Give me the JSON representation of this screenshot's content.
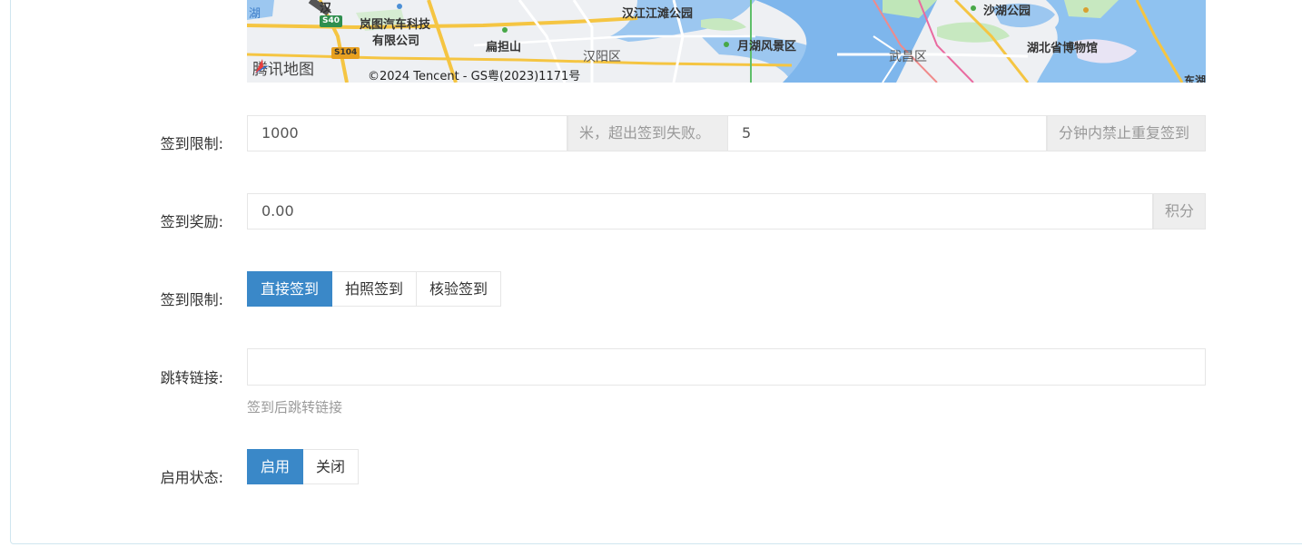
{
  "map": {
    "labels": {
      "han_label": "汉",
      "hu": "湖",
      "langtu": "岚图汽车科技",
      "langtu2": "有限公司",
      "biandanshan": "扁担山",
      "hanyang_district": "汉阳区",
      "hanjiang_park": "汉江江滩公园",
      "yuehu": "月湖风景区",
      "wuchang_district": "武昌区",
      "shahu_park": "沙湖公园",
      "hubei_museum": "湖北省博物馆",
      "dong_edge": "东湖"
    },
    "shields": {
      "s40": "S40",
      "s104": "S104"
    },
    "logo_text": "腾讯地图",
    "copyright": "©2024 Tencent - GS粤(2023)1171号"
  },
  "form": {
    "limit": {
      "label": "签到限制:",
      "distance_value": "1000",
      "distance_suffix": "米，超出签到失败。",
      "minutes_value": "5",
      "minutes_suffix": "分钟内禁止重复签到"
    },
    "reward": {
      "label": "签到奖励:",
      "value": "0.00",
      "suffix": "积分"
    },
    "mode": {
      "label": "签到限制:",
      "options": [
        "直接签到",
        "拍照签到",
        "核验签到"
      ],
      "selected": "直接签到"
    },
    "redirect": {
      "label": "跳转链接:",
      "value": "",
      "help": "签到后跳转链接"
    },
    "status": {
      "label": "启用状态:",
      "options": [
        "启用",
        "关闭"
      ],
      "selected": "启用"
    }
  },
  "colors": {
    "accent": "#3a88c8",
    "addon_bg": "#eeeeee",
    "border": "#e6e6e6"
  }
}
